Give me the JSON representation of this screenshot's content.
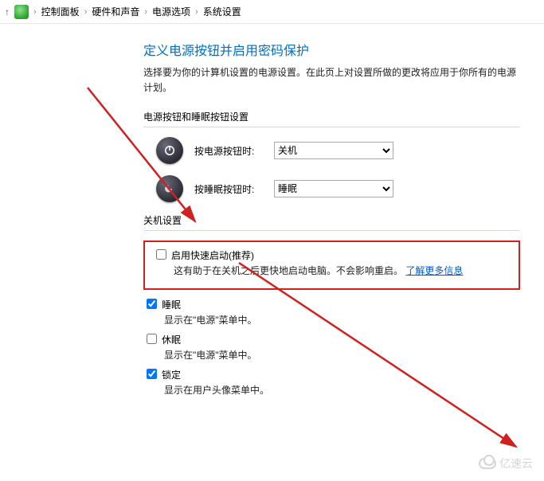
{
  "breadcrumb": {
    "items": [
      "控制面板",
      "硬件和声音",
      "电源选项",
      "系统设置"
    ]
  },
  "title": "定义电源按钮并启用密码保护",
  "desc": "选择要为你的计算机设置的电源设置。在此页上对设置所做的更改将应用于你所有的电源计划。",
  "sections": {
    "buttons_label": "电源按钮和睡眠按钮设置",
    "power_btn_label": "按电源按钮时:",
    "power_btn_value": "关机",
    "sleep_btn_label": "按睡眠按钮时:",
    "sleep_btn_value": "睡眠",
    "shutdown_label": "关机设置",
    "fast_startup": {
      "title": "启用快速启动(推荐)",
      "desc": "这有助于在关机之后更快地启动电脑。不会影响重启。",
      "link": "了解更多信息"
    },
    "sleep": {
      "title": "睡眠",
      "desc": "显示在\"电源\"菜单中。"
    },
    "hibernate": {
      "title": "休眠",
      "desc": "显示在\"电源\"菜单中。"
    },
    "lock": {
      "title": "锁定",
      "desc": "显示在用户头像菜单中。"
    }
  },
  "watermark": "亿速云"
}
